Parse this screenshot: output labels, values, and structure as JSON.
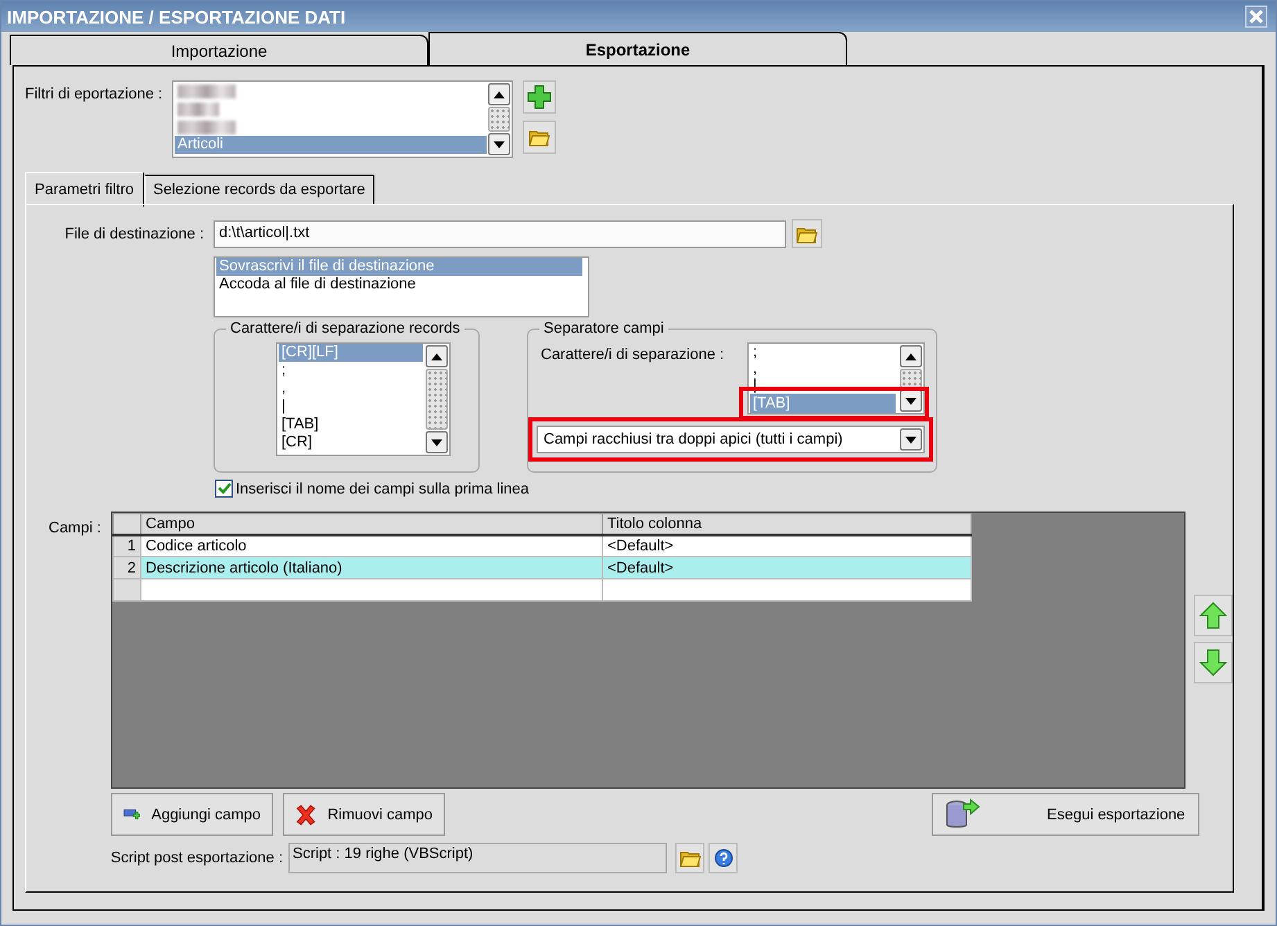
{
  "window": {
    "title": "IMPORTAZIONE / ESPORTAZIONE DATI"
  },
  "tabs": [
    {
      "label": "Importazione",
      "selected": false
    },
    {
      "label": "Esportazione",
      "selected": true
    }
  ],
  "filters": {
    "label": "Filtri di eportazione :",
    "items": [
      {
        "label": "Articoli",
        "selected": true
      }
    ]
  },
  "subtabs": [
    {
      "label": "Parametri filtro",
      "selected": true
    },
    {
      "label": "Selezione records da esportare",
      "selected": false
    }
  ],
  "destination": {
    "label": "File di destinazione :",
    "value": "d:\\t\\articol|.txt"
  },
  "write_modes": [
    {
      "label": "Sovrascrivi il file di destinazione",
      "selected": true
    },
    {
      "label": "Accoda al file di destinazione",
      "selected": false
    }
  ],
  "record_separator": {
    "title": "Carattere/i di separazione records",
    "items": [
      {
        "label": "[CR][LF]",
        "selected": true
      },
      {
        "label": ";",
        "selected": false
      },
      {
        "label": ",",
        "selected": false
      },
      {
        "label": "|",
        "selected": false
      },
      {
        "label": "[TAB]",
        "selected": false
      },
      {
        "label": "[CR]",
        "selected": false
      }
    ]
  },
  "field_separator": {
    "title": "Separatore campi",
    "label": "Carattere/i di separazione :",
    "highlighted": true,
    "items": [
      {
        "label": ";",
        "selected": false
      },
      {
        "label": ",",
        "selected": false
      },
      {
        "label": "|",
        "selected": false
      },
      {
        "label": "[TAB]",
        "selected": true
      }
    ],
    "quote_mode": {
      "value": "Campi racchiusi tra doppi apici (tutti i campi)",
      "highlighted": true
    }
  },
  "header_checkbox": {
    "label": "Inserisci il nome dei campi sulla prima linea",
    "checked": true
  },
  "fields": {
    "label": "Campi :",
    "columns": [
      "Campo",
      "Titolo colonna"
    ],
    "rows": [
      {
        "number": "1",
        "field": "Codice articolo",
        "title": "<Default>",
        "selected": false
      },
      {
        "number": "2",
        "field": "Descrizione articolo (Italiano)",
        "title": "<Default>",
        "selected": true
      }
    ]
  },
  "actions": [
    {
      "kind": "add",
      "label": "Aggiungi campo"
    },
    {
      "kind": "remove",
      "label": "Rimuovi campo"
    },
    {
      "kind": "run",
      "label": "Esegui esportazione"
    }
  ],
  "script": {
    "label": "Script post esportazione :",
    "value": "Script : 19 righe (VBScript)"
  }
}
